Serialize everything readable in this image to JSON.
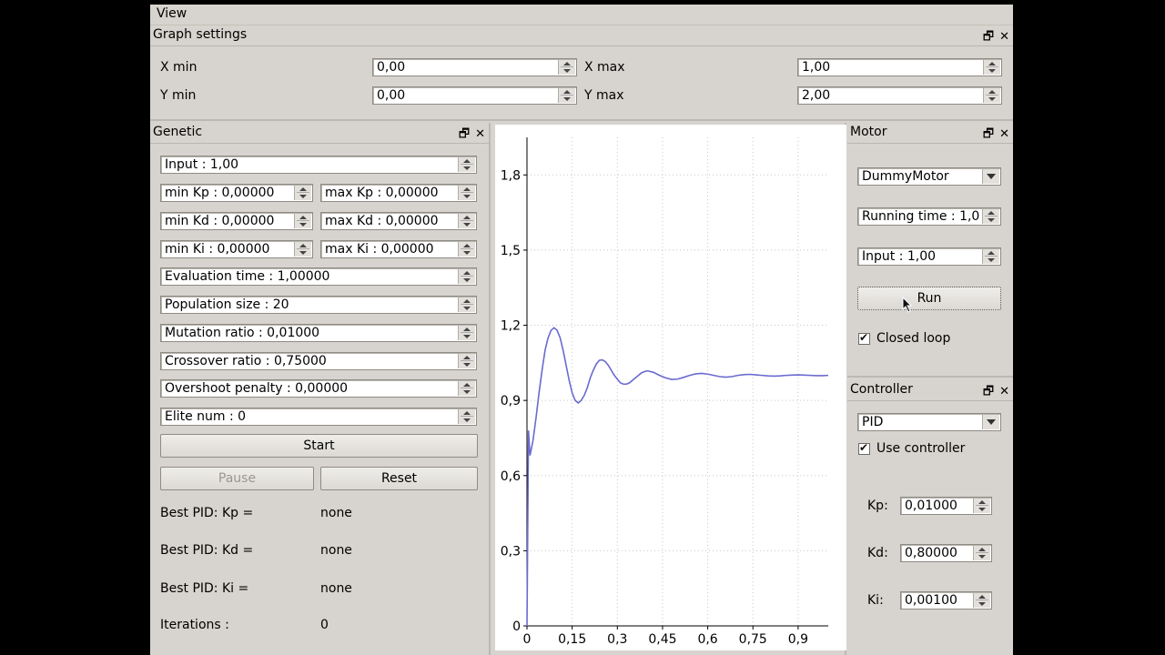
{
  "menu": {
    "view": "View"
  },
  "graph_settings": {
    "title": "Graph settings",
    "xmin_label": "X min",
    "xmin_value": "0,00",
    "xmax_label": "X max",
    "xmax_value": "1,00",
    "ymin_label": "Y min",
    "ymin_value": "0,00",
    "ymax_label": "Y max",
    "ymax_value": "2,00"
  },
  "dock_icons": {
    "float": "🗗",
    "close": "✕"
  },
  "genetic": {
    "title": "Genetic",
    "input": "Input : 1,00",
    "min_kp": "min Kp : 0,00000",
    "max_kp": "max Kp : 0,00000",
    "min_kd": "min Kd : 0,00000",
    "max_kd": "max Kd : 0,00000",
    "min_ki": "min Ki : 0,00000",
    "max_ki": "max Ki : 0,00000",
    "evaluation_time": "Evaluation time : 1,00000",
    "population_size": "Population size : 20",
    "mutation_ratio": "Mutation ratio : 0,01000",
    "crossover_ratio": "Crossover ratio : 0,75000",
    "overshoot_penalty": "Overshoot penalty : 0,00000",
    "elite_num": "Elite num : 0",
    "start": "Start",
    "pause": "Pause",
    "reset": "Reset",
    "best_kp_label": "Best PID: Kp =",
    "best_kp_value": "none",
    "best_kd_label": "Best PID: Kd =",
    "best_kd_value": "none",
    "best_ki_label": "Best PID: Ki =",
    "best_ki_value": "none",
    "iterations_label": "Iterations :",
    "iterations_value": "0"
  },
  "motor": {
    "title": "Motor",
    "type": "DummyMotor",
    "running_time": "Running time : 1,0",
    "input": "Input : 1,00",
    "run": "Run",
    "closed_loop": "Closed loop"
  },
  "controller": {
    "title": "Controller",
    "type": "PID",
    "use_controller": "Use controller",
    "kp_label": "Kp:",
    "kp_value": "0,01000",
    "kd_label": "Kd:",
    "kd_value": "0,80000",
    "ki_label": "Ki:",
    "ki_value": "0,00100"
  },
  "chart_data": {
    "type": "line",
    "xlim": [
      0,
      1.0
    ],
    "ylim": [
      0,
      1.95
    ],
    "x_ticks": [
      0,
      0.15,
      0.3,
      0.45,
      0.6,
      0.75,
      0.9
    ],
    "x_tick_labels": [
      "0",
      "0,15",
      "0,3",
      "0,45",
      "0,6",
      "0,75",
      "0,9"
    ],
    "y_ticks": [
      0,
      0.3,
      0.6,
      0.9,
      1.2,
      1.5,
      1.8
    ],
    "y_tick_labels": [
      "0",
      "0,3",
      "0,6",
      "0,9",
      "1,2",
      "1,5",
      "1,8"
    ],
    "grid": true,
    "line_color": "#6a6ad0",
    "series": [
      {
        "x": [
          0,
          0.005,
          0.01,
          0.02,
          0.03,
          0.04,
          0.05,
          0.06,
          0.07,
          0.08,
          0.09,
          0.1,
          0.11,
          0.12,
          0.13,
          0.14,
          0.15,
          0.16,
          0.17,
          0.18,
          0.19,
          0.2,
          0.21,
          0.22,
          0.23,
          0.24,
          0.25,
          0.26,
          0.27,
          0.28,
          0.29,
          0.3,
          0.31,
          0.32,
          0.33,
          0.34,
          0.35,
          0.36,
          0.37,
          0.38,
          0.39,
          0.4,
          0.42,
          0.44,
          0.46,
          0.48,
          0.5,
          0.52,
          0.54,
          0.56,
          0.58,
          0.6,
          0.62,
          0.64,
          0.66,
          0.68,
          0.7,
          0.72,
          0.74,
          0.76,
          0.78,
          0.8,
          0.82,
          0.84,
          0.86,
          0.88,
          0.9,
          0.92,
          0.94,
          0.96,
          0.98,
          1.0
        ],
        "y": [
          0.0,
          0.78,
          0.68,
          0.74,
          0.83,
          0.93,
          1.02,
          1.1,
          1.15,
          1.18,
          1.19,
          1.18,
          1.15,
          1.1,
          1.04,
          0.98,
          0.93,
          0.9,
          0.89,
          0.9,
          0.92,
          0.95,
          0.99,
          1.02,
          1.045,
          1.06,
          1.062,
          1.055,
          1.04,
          1.02,
          1.0,
          0.985,
          0.97,
          0.965,
          0.965,
          0.97,
          0.98,
          0.99,
          1.0,
          1.01,
          1.015,
          1.018,
          1.012,
          1.0,
          0.99,
          0.984,
          0.985,
          0.992,
          1.0,
          1.006,
          1.008,
          1.005,
          1.0,
          0.995,
          0.993,
          0.995,
          1.0,
          1.003,
          1.004,
          1.002,
          1.0,
          0.998,
          0.997,
          0.998,
          1.0,
          1.001,
          1.002,
          1.001,
          1.0,
          0.999,
          0.999,
          1.0
        ]
      }
    ]
  }
}
